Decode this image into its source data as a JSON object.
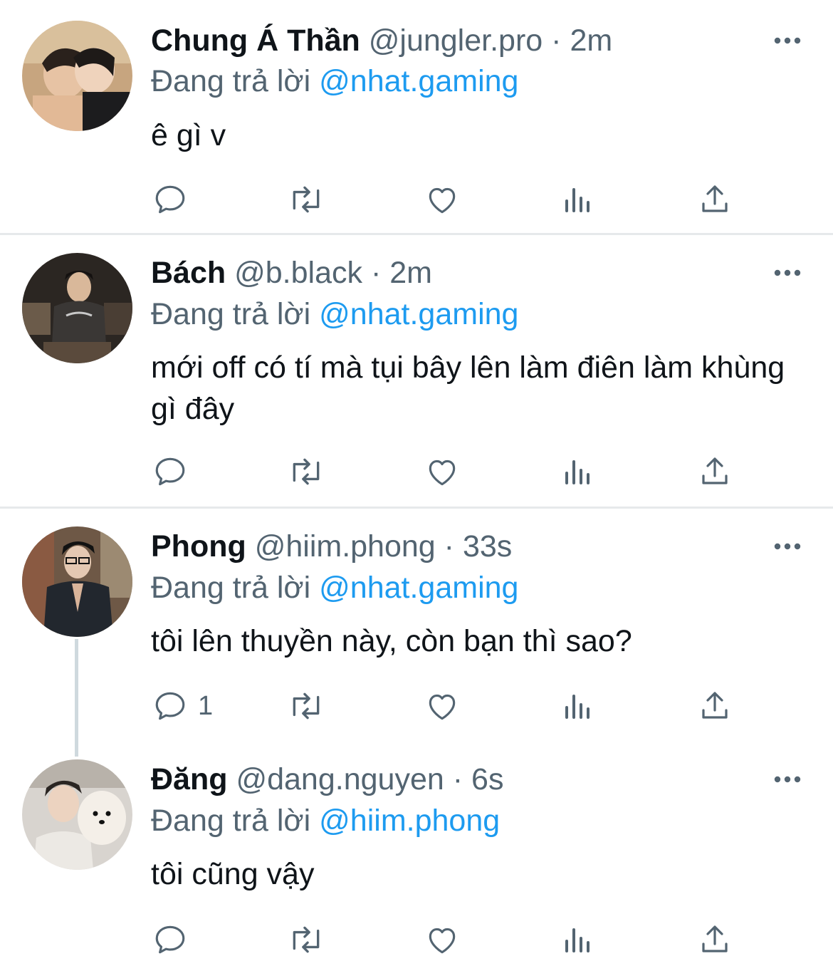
{
  "colors": {
    "mention": "#1d9bf0",
    "meta": "#536471",
    "text": "#0f1419",
    "divider": "#e6e9eb"
  },
  "icons": [
    "reply-icon",
    "retweet-icon",
    "like-icon",
    "views-icon",
    "share-icon",
    "more-icon"
  ],
  "tweets": [
    {
      "name": "Chung Á Thần",
      "handle": "@jungler.pro",
      "separator": "·",
      "time": "2m",
      "reply_prefix": "Đang trả lời",
      "reply_to": "@nhat.gaming",
      "text": "ê gì v",
      "reply_count": ""
    },
    {
      "name": "Bách",
      "handle": "@b.black",
      "separator": "·",
      "time": "2m",
      "reply_prefix": "Đang trả lời",
      "reply_to": "@nhat.gaming",
      "text": "mới off có tí mà tụi bây lên làm điên làm khùng gì đây",
      "reply_count": ""
    },
    {
      "name": "Phong",
      "handle": "@hiim.phong",
      "separator": "·",
      "time": "33s",
      "reply_prefix": "Đang trả lời",
      "reply_to": "@nhat.gaming",
      "text": "tôi lên thuyền này, còn bạn thì sao?",
      "reply_count": "1"
    },
    {
      "name": "Đăng",
      "handle": "@dang.nguyen",
      "separator": "·",
      "time": "6s",
      "reply_prefix": "Đang trả lời",
      "reply_to": "@hiim.phong",
      "text": "tôi cũng vậy",
      "reply_count": ""
    }
  ]
}
